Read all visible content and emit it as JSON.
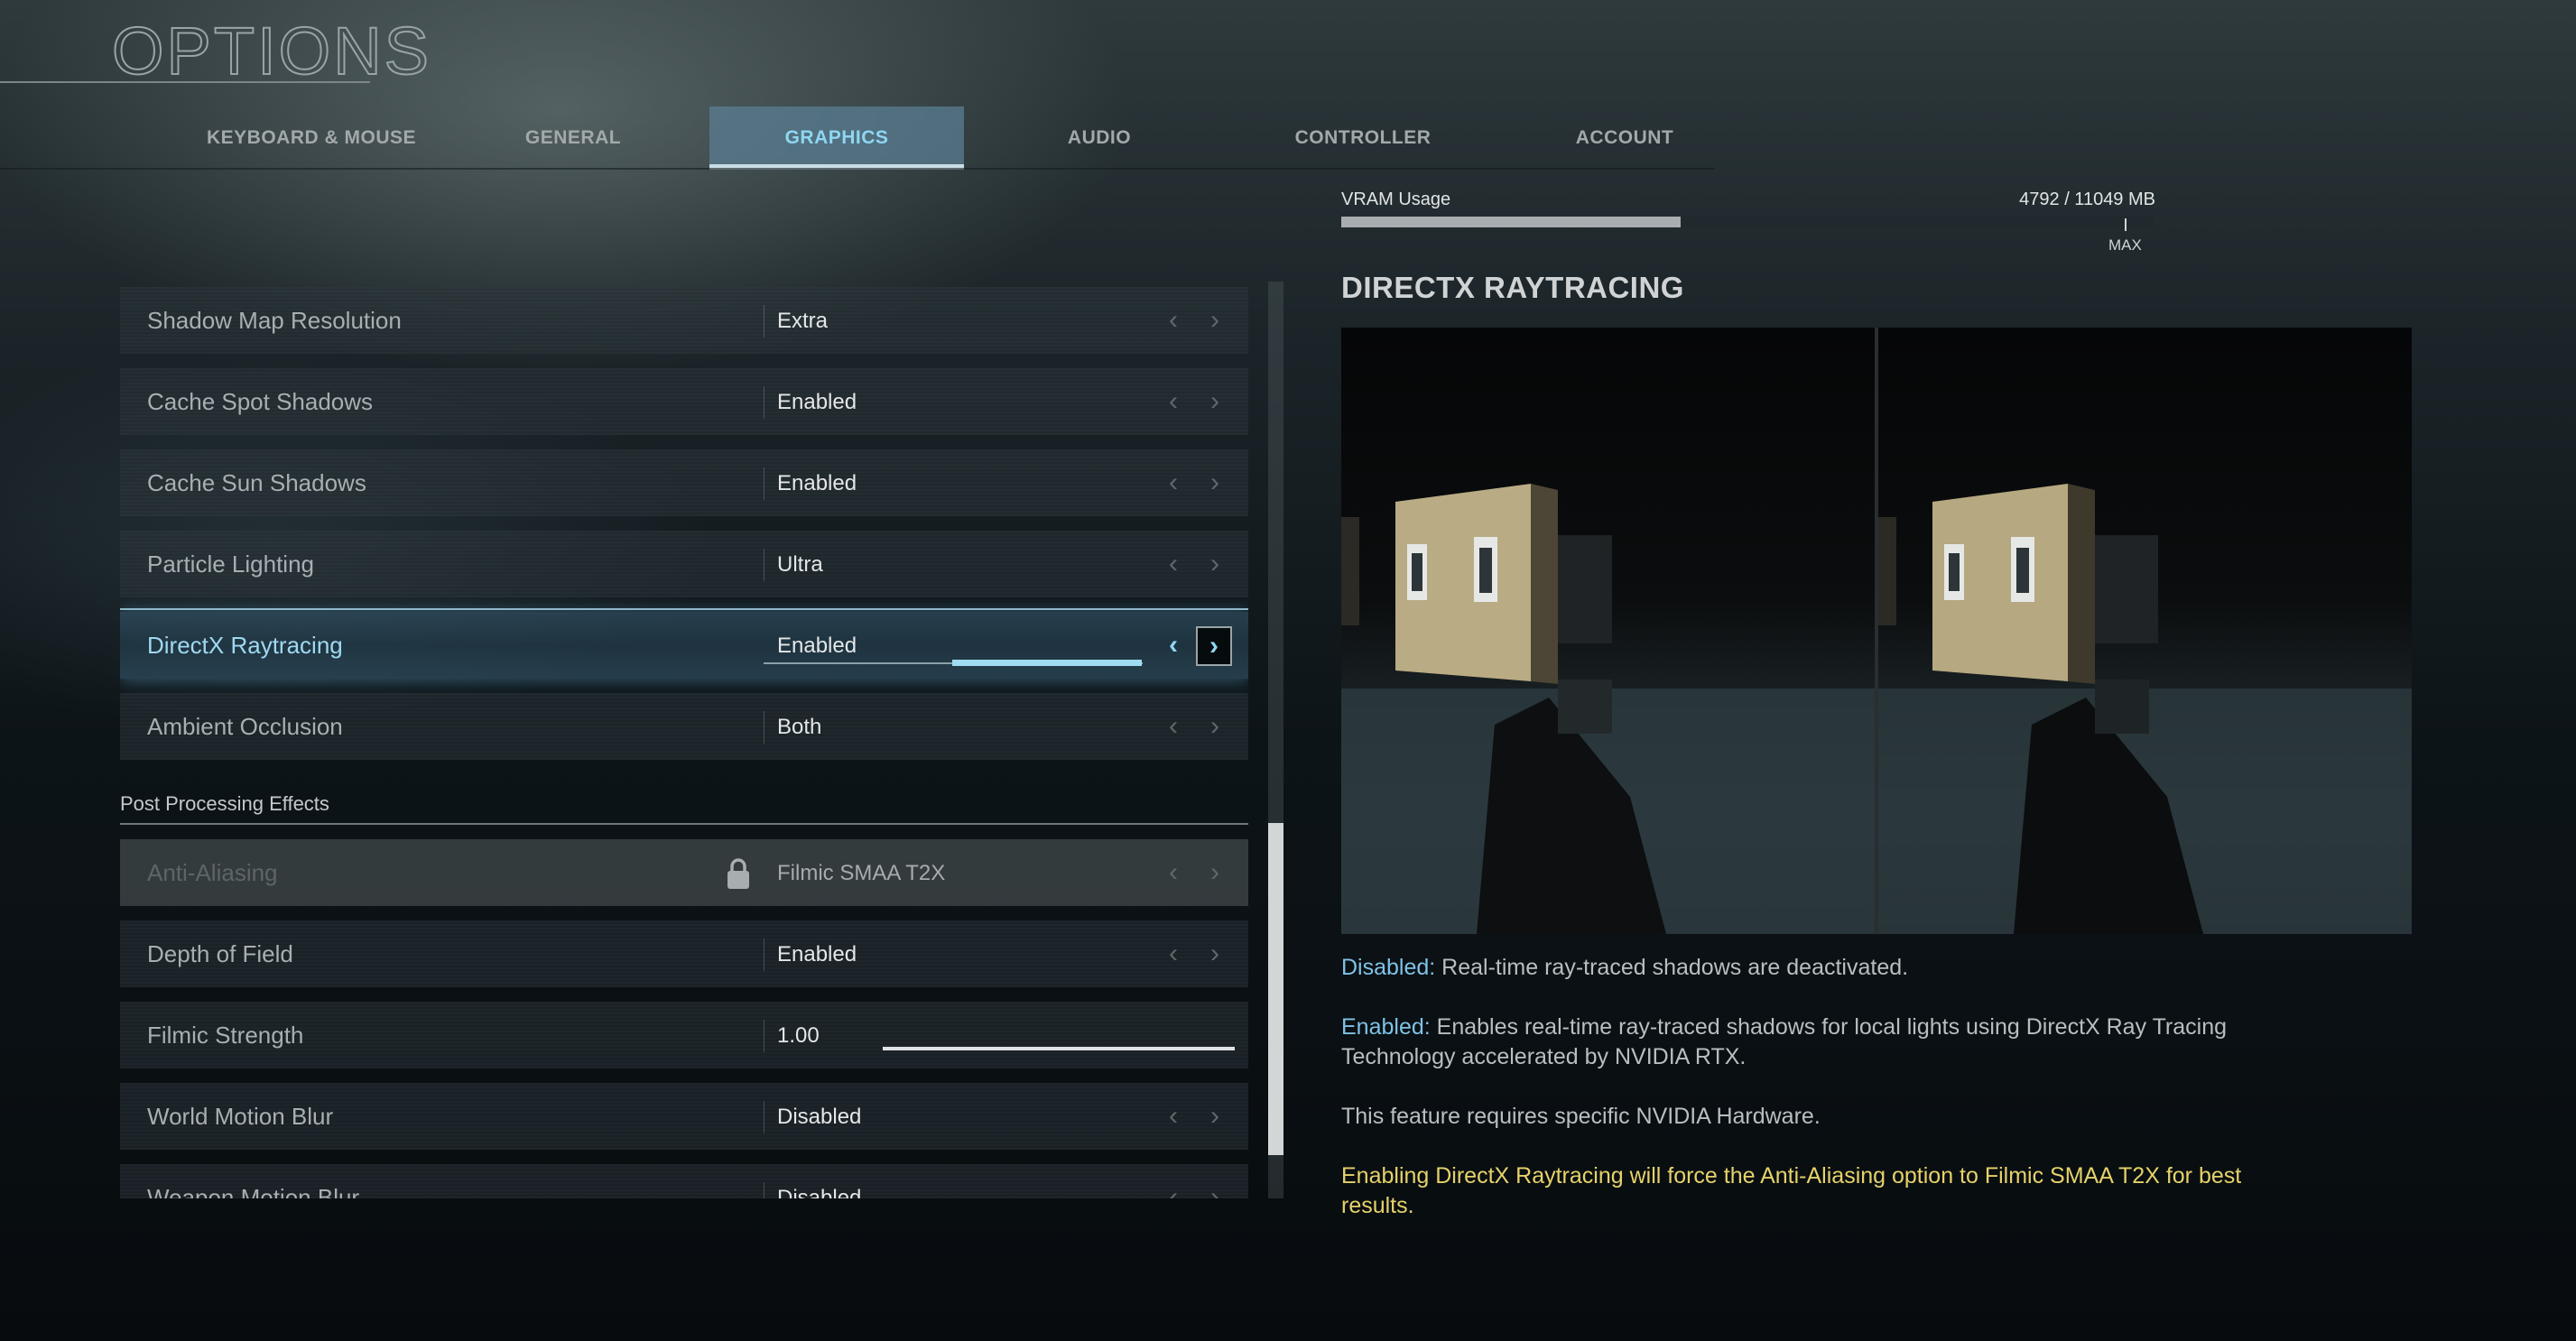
{
  "header": {
    "title": "OPTIONS"
  },
  "tabs": [
    {
      "label": "KEYBOARD & MOUSE",
      "active": false
    },
    {
      "label": "GENERAL",
      "active": false
    },
    {
      "label": "GRAPHICS",
      "active": true
    },
    {
      "label": "AUDIO",
      "active": false
    },
    {
      "label": "CONTROLLER",
      "active": false
    },
    {
      "label": "ACCOUNT",
      "active": false
    }
  ],
  "settings": {
    "rows": [
      {
        "label": "Shadow Map Resolution",
        "value": "Extra"
      },
      {
        "label": "Cache Spot Shadows",
        "value": "Enabled"
      },
      {
        "label": "Cache Sun Shadows",
        "value": "Enabled"
      },
      {
        "label": "Particle Lighting",
        "value": "Ultra"
      },
      {
        "label": "DirectX Raytracing",
        "value": "Enabled",
        "selected": true
      },
      {
        "label": "Ambient Occlusion",
        "value": "Both"
      }
    ],
    "section_header": "Post Processing Effects",
    "post_rows": [
      {
        "label": "Anti-Aliasing",
        "value": "Filmic SMAA T2X",
        "locked": true
      },
      {
        "label": "Depth of Field",
        "value": "Enabled"
      },
      {
        "label": "Filmic Strength",
        "value": "1.00",
        "type": "slider",
        "slider_fraction": 1.0
      },
      {
        "label": "World Motion Blur",
        "value": "Disabled"
      },
      {
        "label": "Weapon Motion Blur",
        "value": "Disabled"
      }
    ],
    "arrow_left_glyph": "‹",
    "arrow_right_glyph": "›"
  },
  "vram": {
    "label": "VRAM Usage",
    "value_text": "4792 / 11049 MB",
    "used_mb": 4792,
    "total_mb": 11049,
    "max_label": "MAX"
  },
  "detail": {
    "title": "DIRECTX RAYTRACING",
    "preview_left_alt": "Raytracing disabled comparison",
    "preview_right_alt": "Raytracing enabled comparison",
    "disabled_key": "Disabled:",
    "disabled_text": " Real-time ray-traced shadows are deactivated.",
    "enabled_key": "Enabled:",
    "enabled_text": " Enables real-time ray-traced shadows for local lights using DirectX Ray Tracing Technology accelerated by NVIDIA RTX.",
    "hardware_note": "This feature requires specific NVIDIA Hardware.",
    "warning": "Enabling DirectX Raytracing will force the Anti-Aliasing option to Filmic SMAA T2X for best results."
  },
  "colors": {
    "accent": "#8fd6f2",
    "warning": "#e6d26a",
    "key_blue": "#7fc3e6"
  }
}
